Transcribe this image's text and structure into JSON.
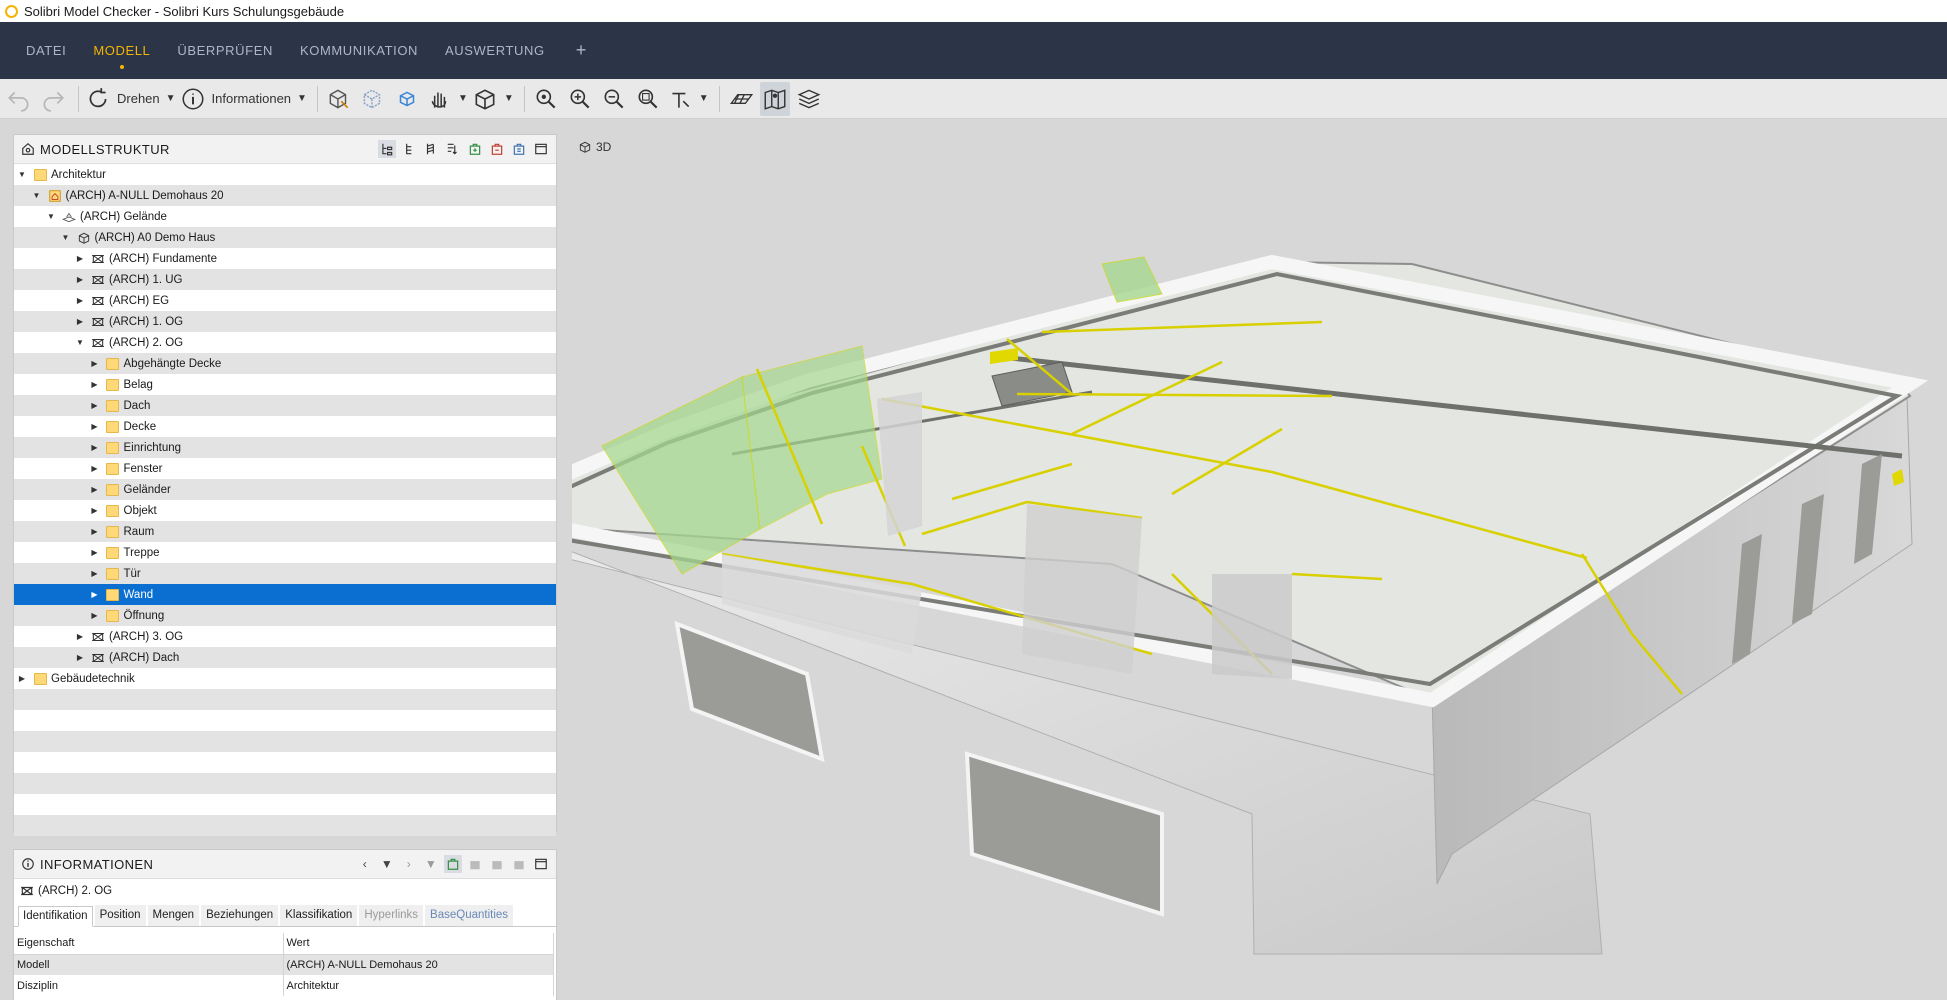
{
  "window": {
    "title": "Solibri Model Checker - Solibri Kurs Schulungsgebäude"
  },
  "menu": {
    "items": [
      "DATEI",
      "MODELL",
      "ÜBERPRÜFEN",
      "KOMMUNIKATION",
      "AUSWERTUNG"
    ],
    "active": "MODELL",
    "add_label": "+"
  },
  "toolbar": {
    "rotate_label": "Drehen",
    "info_label": "Informationen"
  },
  "tree_panel": {
    "title": "MODELLSTRUKTUR",
    "rows": [
      {
        "label": "Architektur",
        "indent": 0,
        "state": "open",
        "icon": "folder-icon"
      },
      {
        "label": "(ARCH) A-NULL Demohaus 20",
        "indent": 1,
        "state": "open",
        "icon": "project-icon"
      },
      {
        "label": "(ARCH) Gelände",
        "indent": 2,
        "state": "open",
        "icon": "site-icon"
      },
      {
        "label": "(ARCH) A0 Demo Haus",
        "indent": 3,
        "state": "open",
        "icon": "building-icon"
      },
      {
        "label": "(ARCH) Fundamente",
        "indent": 4,
        "state": "closed",
        "icon": "storey-icon"
      },
      {
        "label": "(ARCH) 1. UG",
        "indent": 4,
        "state": "closed",
        "icon": "storey-icon"
      },
      {
        "label": "(ARCH) EG",
        "indent": 4,
        "state": "closed",
        "icon": "storey-icon"
      },
      {
        "label": "(ARCH) 1. OG",
        "indent": 4,
        "state": "closed",
        "icon": "storey-icon"
      },
      {
        "label": "(ARCH) 2. OG",
        "indent": 4,
        "state": "open",
        "icon": "storey-icon"
      },
      {
        "label": "Abgehängte Decke",
        "indent": 5,
        "state": "closed",
        "icon": "folder-icon"
      },
      {
        "label": "Belag",
        "indent": 5,
        "state": "closed",
        "icon": "folder-icon"
      },
      {
        "label": "Dach",
        "indent": 5,
        "state": "closed",
        "icon": "folder-icon"
      },
      {
        "label": "Decke",
        "indent": 5,
        "state": "closed",
        "icon": "folder-icon"
      },
      {
        "label": "Einrichtung",
        "indent": 5,
        "state": "closed",
        "icon": "folder-icon"
      },
      {
        "label": "Fenster",
        "indent": 5,
        "state": "closed",
        "icon": "folder-icon"
      },
      {
        "label": "Geländer",
        "indent": 5,
        "state": "closed",
        "icon": "folder-icon"
      },
      {
        "label": "Objekt",
        "indent": 5,
        "state": "closed",
        "icon": "folder-icon"
      },
      {
        "label": "Raum",
        "indent": 5,
        "state": "closed",
        "icon": "folder-icon"
      },
      {
        "label": "Treppe",
        "indent": 5,
        "state": "closed",
        "icon": "folder-icon"
      },
      {
        "label": "Tür",
        "indent": 5,
        "state": "closed",
        "icon": "folder-icon"
      },
      {
        "label": "Wand",
        "indent": 5,
        "state": "closed",
        "icon": "folder-icon",
        "selected": true
      },
      {
        "label": "Öffnung",
        "indent": 5,
        "state": "closed",
        "icon": "folder-icon"
      },
      {
        "label": "(ARCH) 3. OG",
        "indent": 4,
        "state": "closed",
        "icon": "storey-icon"
      },
      {
        "label": "(ARCH) Dach",
        "indent": 4,
        "state": "closed",
        "icon": "storey-icon"
      },
      {
        "label": "Gebäudetechnik",
        "indent": 0,
        "state": "closed",
        "icon": "folder-icon"
      },
      {
        "label": "",
        "indent": 0,
        "state": "none"
      },
      {
        "label": "",
        "indent": 0,
        "state": "none"
      },
      {
        "label": "",
        "indent": 0,
        "state": "none"
      },
      {
        "label": "",
        "indent": 0,
        "state": "none"
      },
      {
        "label": "",
        "indent": 0,
        "state": "none"
      },
      {
        "label": "",
        "indent": 0,
        "state": "none"
      },
      {
        "label": "",
        "indent": 0,
        "state": "none"
      }
    ]
  },
  "info_panel": {
    "title": "INFORMATIONEN",
    "selected_object": "(ARCH) 2. OG",
    "tabs": [
      {
        "label": "Identifikation",
        "state": "active"
      },
      {
        "label": "Position",
        "state": "normal"
      },
      {
        "label": "Mengen",
        "state": "normal"
      },
      {
        "label": "Beziehungen",
        "state": "normal"
      },
      {
        "label": "Klassifikation",
        "state": "normal"
      },
      {
        "label": "Hyperlinks",
        "state": "dim"
      },
      {
        "label": "BaseQuantities",
        "state": "blue"
      }
    ],
    "columns": [
      "Eigenschaft",
      "Wert"
    ],
    "rows": [
      [
        "Modell",
        "(ARCH) A-NULL Demohaus 20"
      ],
      [
        "Disziplin",
        "Architektur"
      ]
    ]
  },
  "view": {
    "label": "3D"
  },
  "colors": {
    "menubar_bg": "#2c3547",
    "menu_active": "#f4b400",
    "selection": "#0a6fd1",
    "highlight_yellow": "#d8d000",
    "highlight_green": "#a4d98b"
  }
}
